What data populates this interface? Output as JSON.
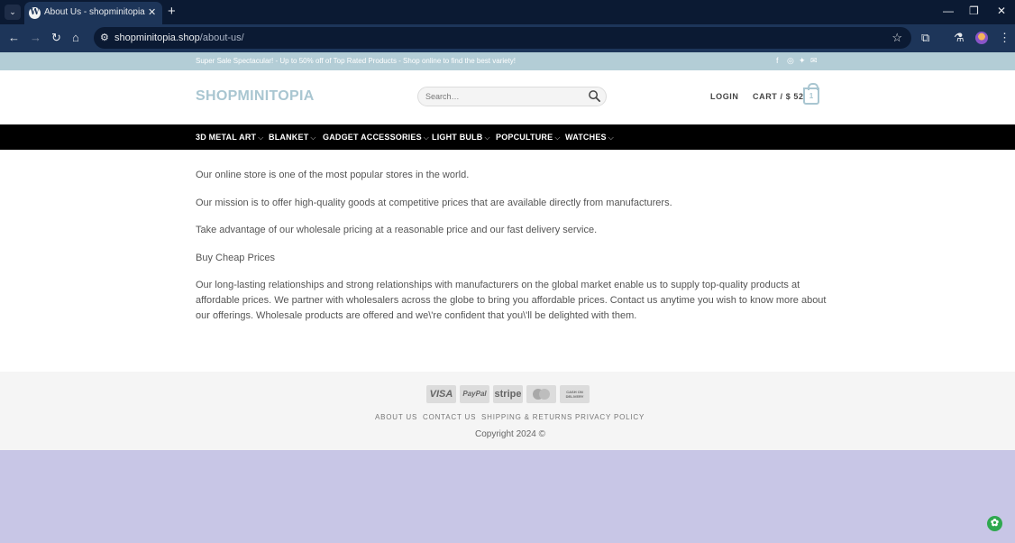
{
  "browser": {
    "tab_title": "About Us - shopminitopia",
    "url_host": "shopminitopia.shop",
    "url_path": "/about-us/"
  },
  "icons": {
    "tab_menu": "chevron-down-icon",
    "favicon": "wordpress-icon",
    "tab_close": "close-icon",
    "new_tab": "plus-icon",
    "minimize": "minimize-icon",
    "restore": "restore-icon",
    "window_close": "close-icon",
    "back": "back-arrow-icon",
    "forward": "forward-arrow-icon",
    "reload": "reload-icon",
    "home": "home-icon",
    "site_info": "tune-icon",
    "bookmark": "star-icon",
    "extensions": "puzzle-icon",
    "labs": "flask-icon",
    "menu": "kebab-menu-icon"
  },
  "site": {
    "promo": "Super Sale Spectacular! - Up to 50% off of Top Rated Products - Shop online to find the best variety!",
    "logo": "SHOPMINITOPIA",
    "search_placeholder": "Search…",
    "login": "LOGIN",
    "cart_label": "CART / $ 52",
    "cart_count": "1",
    "nav": [
      {
        "label": "3D METAL ART"
      },
      {
        "label": "BLANKET"
      },
      {
        "label": "GADGET ACCESSORIES"
      },
      {
        "label": "LIGHT BULB"
      },
      {
        "label": "POPCULTURE"
      },
      {
        "label": "WATCHES"
      }
    ]
  },
  "content": {
    "p1": "Our online store is one of the most popular stores in the world.",
    "p2": "Our mission is to offer high-quality goods at competitive prices that are available directly from manufacturers.",
    "p3": "Take advantage of our wholesale pricing at a reasonable price and our fast delivery service.",
    "p4": "Buy Cheap Prices",
    "p5": "Our long-lasting relationships and strong relationships with manufacturers on the global market enable us to supply top-quality products at affordable prices. We partner with wholesalers across the globe to bring you affordable prices. Contact us anytime you wish to know more about our offerings. Wholesale products are offered and we\\'re confident that you\\'ll be delighted with them."
  },
  "footer": {
    "payments": {
      "visa": "VISA",
      "paypal": "PayPal",
      "stripe": "stripe",
      "cod": "CASH ON DELIVERY"
    },
    "links": [
      "ABOUT US",
      "CONTACT US",
      "SHIPPING & RETURNS",
      "PRIVACY POLICY"
    ],
    "copyright": "Copyright 2024 ©"
  },
  "colors": {
    "topbar": "#b3cdd6",
    "accent": "#a9c6d1",
    "nav_bg": "#000000",
    "page_bottom": "#c8c6e6"
  }
}
